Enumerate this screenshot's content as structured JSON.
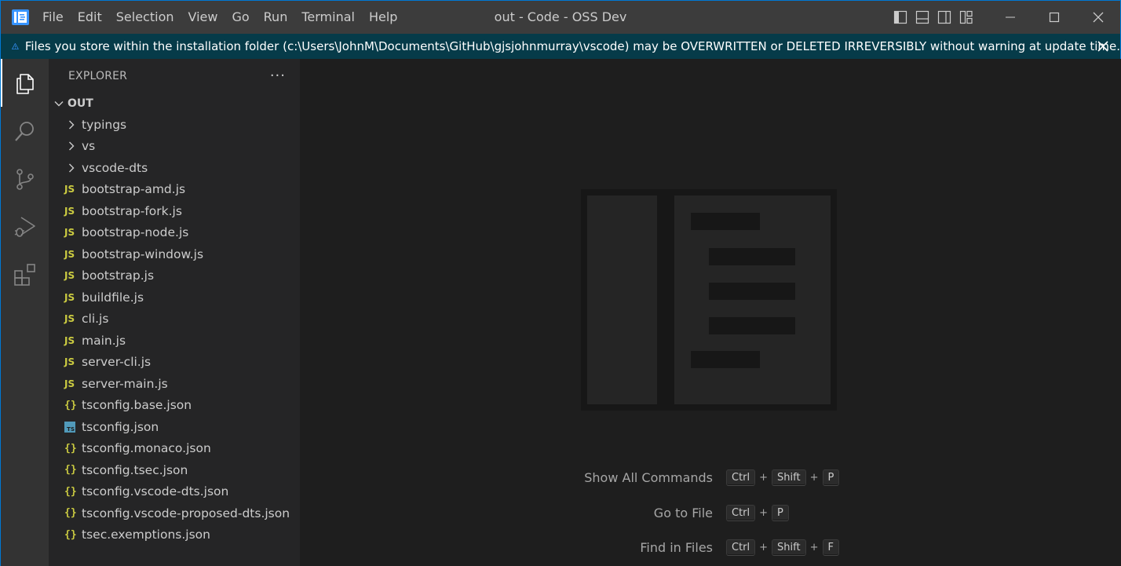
{
  "titlebar": {
    "menu": [
      "File",
      "Edit",
      "Selection",
      "View",
      "Go",
      "Run",
      "Terminal",
      "Help"
    ],
    "window_title": "out - Code - OSS Dev"
  },
  "banner": {
    "message": "Files you store within the installation folder (c:\\Users\\JohnM\\Documents\\GitHub\\gjsjohnmurray\\vscode) may be OVERWRITTEN or DELETED IRREVERSIBLY without warning at update time."
  },
  "activitybar": {
    "items": [
      "explorer-icon",
      "search-icon",
      "source-control-icon",
      "run-debug-icon",
      "extensions-icon"
    ],
    "active": "explorer-icon"
  },
  "sidebar": {
    "title": "EXPLORER",
    "more": "···",
    "section": "OUT",
    "folders": [
      {
        "label": "typings"
      },
      {
        "label": "vs"
      },
      {
        "label": "vscode-dts"
      }
    ],
    "files": [
      {
        "label": "bootstrap-amd.js",
        "icon": "JS"
      },
      {
        "label": "bootstrap-fork.js",
        "icon": "JS"
      },
      {
        "label": "bootstrap-node.js",
        "icon": "JS"
      },
      {
        "label": "bootstrap-window.js",
        "icon": "JS"
      },
      {
        "label": "bootstrap.js",
        "icon": "JS"
      },
      {
        "label": "buildfile.js",
        "icon": "JS"
      },
      {
        "label": "cli.js",
        "icon": "JS"
      },
      {
        "label": "main.js",
        "icon": "JS"
      },
      {
        "label": "server-cli.js",
        "icon": "JS"
      },
      {
        "label": "server-main.js",
        "icon": "JS"
      },
      {
        "label": "tsconfig.base.json",
        "icon": "{}"
      },
      {
        "label": "tsconfig.json",
        "icon": "TS"
      },
      {
        "label": "tsconfig.monaco.json",
        "icon": "{}"
      },
      {
        "label": "tsconfig.tsec.json",
        "icon": "{}"
      },
      {
        "label": "tsconfig.vscode-dts.json",
        "icon": "{}"
      },
      {
        "label": "tsconfig.vscode-proposed-dts.json",
        "icon": "{}"
      },
      {
        "label": "tsec.exemptions.json",
        "icon": "{}"
      }
    ]
  },
  "editor": {
    "shortcuts": [
      {
        "label": "Show All Commands",
        "keys": [
          "Ctrl",
          "Shift",
          "P"
        ]
      },
      {
        "label": "Go to File",
        "keys": [
          "Ctrl",
          "P"
        ]
      },
      {
        "label": "Find in Files",
        "keys": [
          "Ctrl",
          "Shift",
          "F"
        ]
      }
    ],
    "key_separator": "+"
  },
  "colors": {
    "titlebar_bg": "#3c3c3c",
    "banner_bg": "#063b49",
    "activitybar_bg": "#333333",
    "sidebar_bg": "#252526",
    "editor_bg": "#1e1e1e",
    "accent": "#0078d4",
    "js_icon": "#cbcb41",
    "ts_icon": "#519aba"
  }
}
